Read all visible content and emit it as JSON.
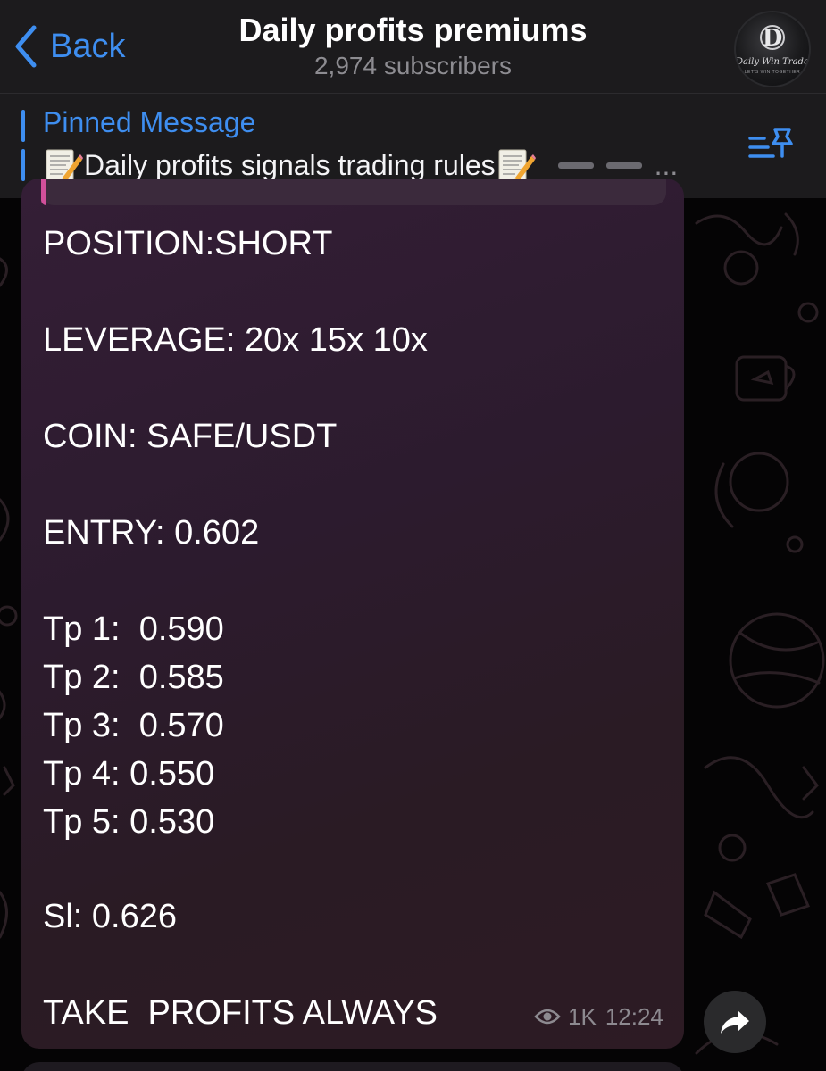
{
  "header": {
    "back_label": "Back",
    "title": "Daily profits premiums",
    "subtitle": "2,974 subscribers",
    "avatar": {
      "letter": "D",
      "brand": "Daily Win Trades",
      "tagline": "LET'S WIN TOGETHER"
    }
  },
  "pinned": {
    "title": "Pinned Message",
    "text": "Daily profits signals trading rules",
    "ellipsis": "...",
    "icon": "pinned-list-icon"
  },
  "message": {
    "lines": [
      "POSITION:SHORT",
      "LEVERAGE: 20x 15x 10x",
      "COIN: SAFE/USDT",
      "ENTRY: 0.602",
      "Tp 1:  0.590",
      "Tp 2:  0.585",
      "Tp 3:  0.570",
      "Tp 4: 0.550",
      "Tp 5: 0.530",
      "Sl: 0.626",
      "TAKE  PROFITS ALWAYS"
    ],
    "views": "1K",
    "time": "12:24"
  },
  "colors": {
    "accent": "#3e8ef0",
    "header_bg": "#1c1b1d",
    "bubble_bg": "#2e1c2d",
    "text": "#ffffff",
    "meta": "#8d8a90"
  }
}
